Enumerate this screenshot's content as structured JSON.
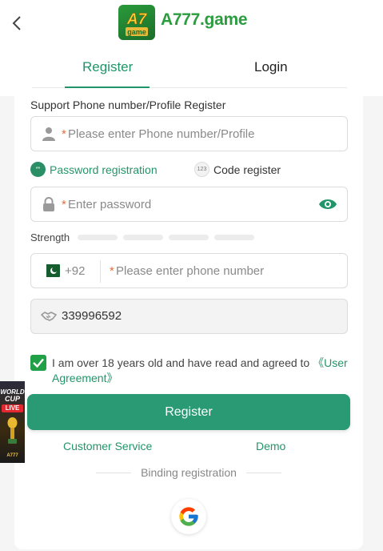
{
  "header": {
    "brand": "A777.game",
    "logo_top": "A7",
    "logo_bottom": "game"
  },
  "tabs": [
    {
      "label": "Register",
      "active": true
    },
    {
      "label": "Login",
      "active": false
    }
  ],
  "form": {
    "section_label": "Support Phone number/Profile Register",
    "phone_profile": {
      "required_mark": "*",
      "placeholder": "Please enter Phone number/Profile"
    },
    "options": {
      "password": {
        "badge": "**",
        "label": "Password registration"
      },
      "code": {
        "badge": "123",
        "label": "Code register"
      }
    },
    "password": {
      "required_mark": "*",
      "placeholder": "Enter password"
    },
    "strength_label": "Strength",
    "phone": {
      "country_code": "+92",
      "required_mark": "*",
      "placeholder": "Please enter phone number"
    },
    "referral_code": "339996592",
    "agreement": {
      "checked": true,
      "text": "I am over 18 years old and have read and agreed to ",
      "link": "《User Agreement》"
    },
    "register_button": "Register",
    "customer_service": "Customer Service",
    "demo": "Demo",
    "binding_label": "Binding registration"
  },
  "ad": {
    "line1": "WORLD",
    "line2": "CUP",
    "live": "LIVE",
    "footer": "A777"
  },
  "colors": {
    "accent": "#22956a",
    "brand_green": "#2a9d3e",
    "required": "#e0703a",
    "button": "#2a9a74"
  }
}
